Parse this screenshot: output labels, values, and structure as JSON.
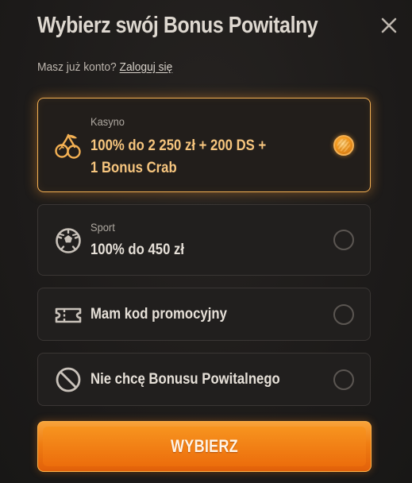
{
  "modal": {
    "title": "Wybierz swój Bonus Powitalny",
    "subtitle_prefix": "Masz już konto?",
    "login_link": "Zaloguj się"
  },
  "options": [
    {
      "id": "casino",
      "label": "Kasyno",
      "line1": "100% do 2 250 zł + 200 DS +",
      "line2": "1 Bonus Crab",
      "icon": "cherries-icon",
      "selected": true
    },
    {
      "id": "sport",
      "label": "Sport",
      "line1": "100% do 450 zł",
      "icon": "soccer-ball-icon",
      "selected": false
    },
    {
      "id": "promo",
      "line1": "Mam kod promocyjny",
      "icon": "ticket-icon",
      "selected": false
    },
    {
      "id": "none",
      "line1": "Nie chcę Bonusu Powitalnego",
      "icon": "prohibited-icon",
      "selected": false
    }
  ],
  "cta": {
    "label": "WYBIERZ"
  },
  "colors": {
    "accent": "#f3b053",
    "selected_text": "#f6c57e",
    "button": "#ef7d12",
    "background": "#1e1c1b"
  }
}
